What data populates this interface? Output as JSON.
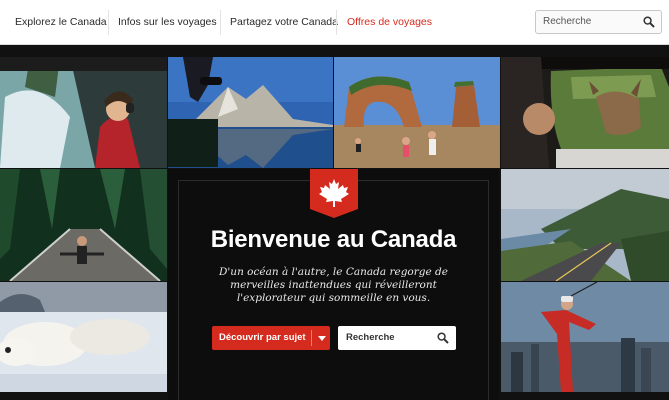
{
  "nav": {
    "items": [
      {
        "label": "Explorez le Canada"
      },
      {
        "label": "Infos sur les voyages"
      },
      {
        "label": "Partagez votre Canada"
      },
      {
        "label": "Offres de voyages"
      }
    ],
    "search_placeholder": "Recherche"
  },
  "hero": {
    "title": "Bienvenue au Canada",
    "subtitle_line1": "D'un océan à l'autre, le Canada regorge de",
    "subtitle_line2": "merveilles inattendues qui réveilleront",
    "subtitle_line3": "l'explorateur qui sommeille en vous.",
    "discover_label": "Découvrir par sujet",
    "search_placeholder": "Recherche"
  },
  "colors": {
    "accent": "#d52b1e",
    "nav_bg": "#ffffff",
    "panel_bg": "#0d0d0d"
  }
}
